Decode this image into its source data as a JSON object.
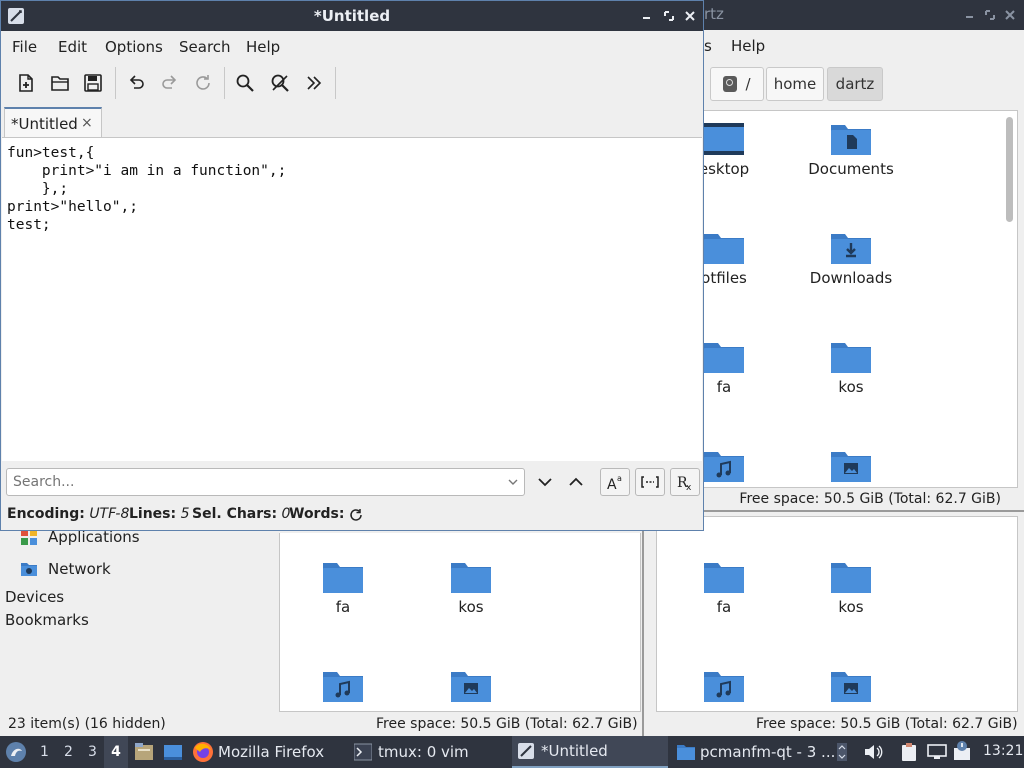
{
  "filemanager": {
    "title_partial": "rtz",
    "menu_partial": [
      "s",
      "Help"
    ],
    "path": [
      "/",
      "home",
      "dartz"
    ],
    "top_pane_items": [
      "esktop",
      "Documents",
      "otfiles",
      "Downloads",
      "fa",
      "kos",
      "",
      ""
    ],
    "top_status": "Free space: 50.5 GiB (Total: 62.7 GiB)",
    "bottom_left_items": [
      "fa",
      "kos",
      "",
      ""
    ],
    "bottom_right_items": [
      "fa",
      "kos",
      "",
      ""
    ],
    "status_items": "23 item(s) (16 hidden)",
    "status_free_left": "Free space: 50.5 GiB (Total: 62.7 GiB)",
    "status_free_right": "Free space: 50.5 GiB (Total: 62.7 GiB)",
    "side": {
      "applications": "Applications",
      "network": "Network",
      "devices": "Devices",
      "bookmarks": "Bookmarks"
    }
  },
  "editor": {
    "title": "*Untitled",
    "menu": [
      "File",
      "Edit",
      "Options",
      "Search",
      "Help"
    ],
    "toolbar_icons": [
      "new-document-icon",
      "open-folder-icon",
      "save-icon",
      "undo-icon",
      "redo-icon",
      "reload-icon",
      "find-icon",
      "replace-icon",
      "more-icon"
    ],
    "tab_label": "*Untitled",
    "tab_close": "×",
    "code": "fun>test,{\n    print>\"i am in a function\",;\n    },;\nprint>\"hello\",;\ntest;",
    "search_placeholder": "Search...",
    "status": {
      "encoding_label": "Encoding:",
      "encoding_value": "UTF-8",
      "lines_label": "Lines:",
      "lines_value": "5",
      "selchars_label": "Sel. Chars:",
      "selchars_value": "0",
      "words_label": "Words:"
    }
  },
  "taskbar": {
    "workspaces": [
      "1",
      "2",
      "3",
      "4"
    ],
    "active_workspace": "4",
    "tasks": [
      "Mozilla Firefox",
      "tmux: 0 vim",
      "*Untitled",
      "pcmanfm-qt - 3 ..."
    ],
    "clock": "13:21"
  },
  "colors": {
    "folder": "#4a8fdb",
    "folder_dark": "#3b7bc6",
    "titlebar": "#2f343f",
    "accent": "#5e81ac"
  }
}
